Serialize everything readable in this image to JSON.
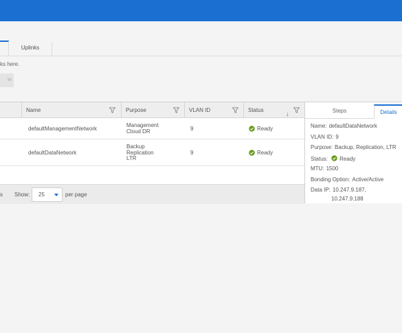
{
  "tabs": {
    "uplinks": "Uplinks"
  },
  "hint_text": "ks here.",
  "faded_button": "te",
  "grid": {
    "columns": [
      {
        "label": "Name"
      },
      {
        "label": "Purpose"
      },
      {
        "label": "VLAN ID"
      },
      {
        "label": "Status"
      }
    ],
    "rows": [
      {
        "name": "defaultManagementNetwork",
        "purpose": [
          "Management",
          "Cloud DR"
        ],
        "vlan": "9",
        "status": "Ready"
      },
      {
        "name": "defaultDataNetwork",
        "purpose": [
          "Backup",
          "Replication",
          "LTR"
        ],
        "vlan": "9",
        "status": "Ready"
      }
    ],
    "footer": {
      "count_suffix": "s",
      "show_label": "Show:",
      "page_size": "25",
      "per_page": "per page"
    }
  },
  "panel": {
    "tabs": {
      "steps": "Steps",
      "details": "Details"
    },
    "name_label": "Name:",
    "name_value": "defaultDataNetwork",
    "vlan_label": "VLAN ID:",
    "vlan_value": "9",
    "purpose_label": "Purpose:",
    "purpose_value": "Backup, Replication, LTR",
    "status_label": "Status:",
    "status_value": "Ready",
    "mtu_label": "MTU:",
    "mtu_value": "1500",
    "bonding_label": "Bonding Option:",
    "bonding_value": "Active/Active",
    "dataip_label": "Data IP:",
    "dataip_values": [
      "10.247.9.187,",
      "10.247.9.188"
    ]
  },
  "colors": {
    "brand": "#1b6fd0",
    "ready": "#6a9a1f"
  },
  "icons": {
    "filter": "filter-icon",
    "sort": "sort-down-icon",
    "ready": "check-circle-icon"
  }
}
